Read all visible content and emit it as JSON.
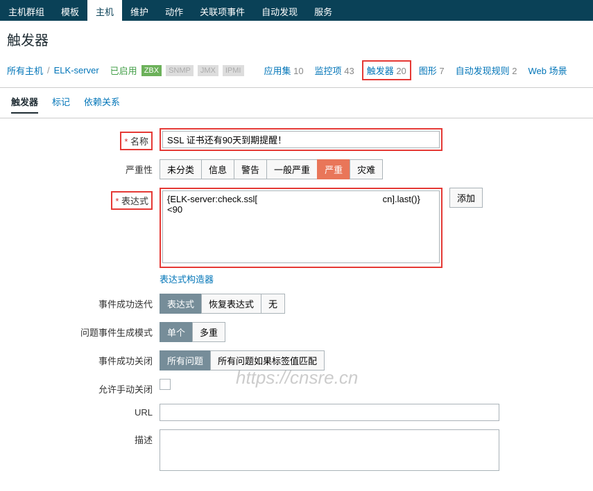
{
  "topnav": [
    "主机群组",
    "模板",
    "主机",
    "维护",
    "动作",
    "关联项事件",
    "自动发现",
    "服务"
  ],
  "topnav_active": 2,
  "page_title": "触发器",
  "breadcrumb": {
    "all_hosts": "所有主机",
    "host": "ELK-server",
    "status": "已启用"
  },
  "badges": [
    "ZBX",
    "SNMP",
    "JMX",
    "IPMI"
  ],
  "subnav": [
    {
      "label": "应用集",
      "count": "10"
    },
    {
      "label": "监控项",
      "count": "43"
    },
    {
      "label": "触发器",
      "count": "20"
    },
    {
      "label": "图形",
      "count": "7"
    },
    {
      "label": "自动发现规则",
      "count": "2"
    },
    {
      "label": "Web 场景",
      "count": ""
    }
  ],
  "tabs": [
    "触发器",
    "标记",
    "依赖关系"
  ],
  "form": {
    "name_label": "名称",
    "name_value": "SSL 证书还有90天到期提醒！",
    "severity_label": "严重性",
    "severity_opts": [
      "未分类",
      "信息",
      "警告",
      "一般严重",
      "严重",
      "灾难"
    ],
    "expr_label": "表达式",
    "expr_value": "{ELK-server:check.ssl[                                                  cn].last()}<90",
    "add_btn": "添加",
    "expr_builder": "表达式构造器",
    "ok_iter_label": "事件成功迭代",
    "ok_iter_opts": [
      "表达式",
      "恢复表达式",
      "无"
    ],
    "problem_mode_label": "问题事件生成模式",
    "problem_mode_opts": [
      "单个",
      "多重"
    ],
    "ok_close_label": "事件成功关闭",
    "ok_close_opts": [
      "所有问题",
      "所有问题如果标签值匹配"
    ],
    "manual_close_label": "允许手动关闭",
    "url_label": "URL",
    "desc_label": "描述"
  },
  "watermark": "https://cnsre.cn"
}
